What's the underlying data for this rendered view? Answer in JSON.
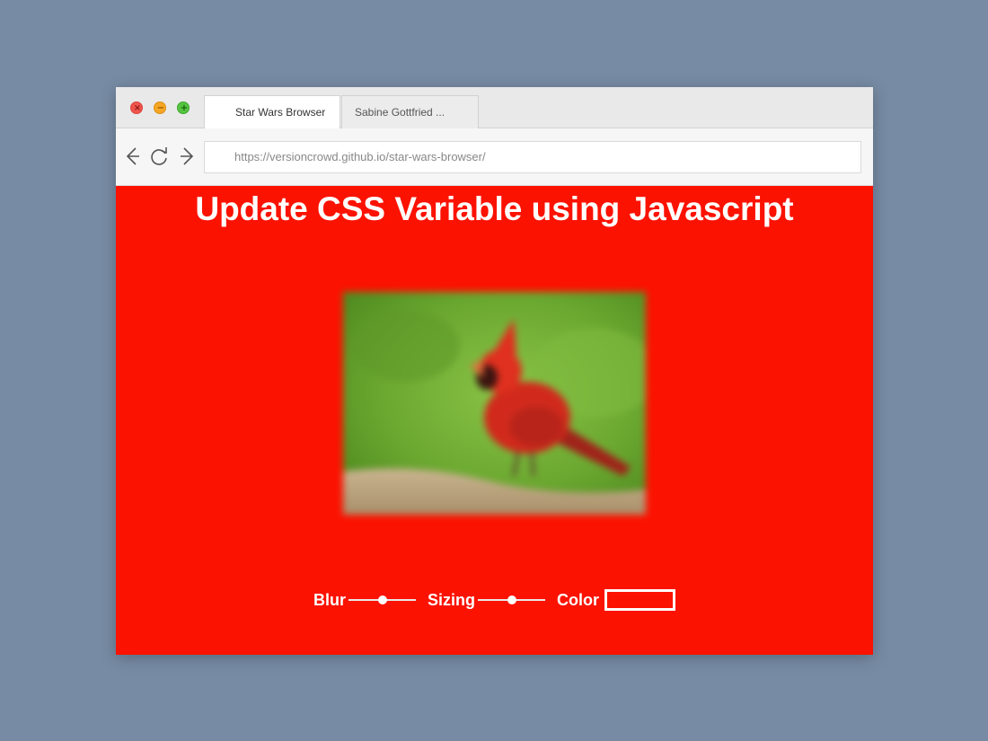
{
  "browser": {
    "tabs": [
      {
        "label": "Star Wars Browser",
        "active": true
      },
      {
        "label": "Sabine Gottfried ...",
        "active": false
      }
    ],
    "url": "https://versioncrowd.github.io/star-wars-browser/"
  },
  "page": {
    "title": "Update CSS Variable using Javascript",
    "background_color": "#fc1201",
    "image_subject": "red cardinal bird (blurred)",
    "controls": {
      "blur_label": "Blur",
      "blur_value": 0.5,
      "sizing_label": "Sizing",
      "sizing_value": 0.5,
      "color_label": "Color",
      "color_value": "#fc1201"
    }
  },
  "colors": {
    "desktop": "#778ba4",
    "accent": "#fc1201"
  }
}
